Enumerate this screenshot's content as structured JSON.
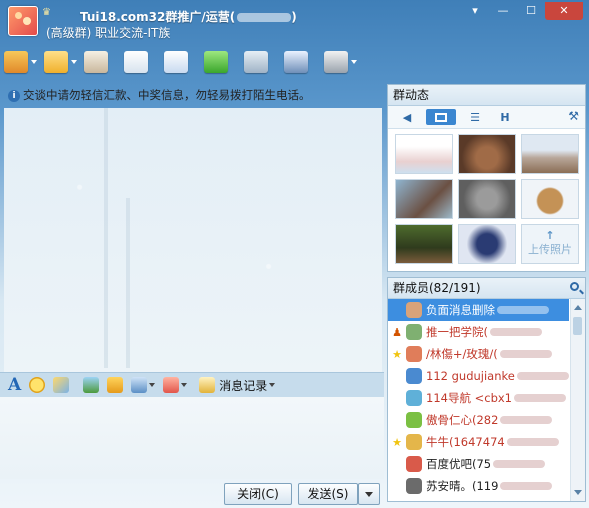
{
  "titlebar": {
    "title": "Tui18.com32群推广/运营(",
    "subtitle": "(高级群) 职业交流-IT族",
    "ctrl_skin": "▾",
    "ctrl_min": "—",
    "ctrl_max": "☐",
    "ctrl_close": "✕"
  },
  "toolbar": {
    "icons": [
      "home-icon",
      "folder-icon",
      "sidebar-icon",
      "card-icon",
      "email-icon",
      "add-icon",
      "settings-tool-icon",
      "user-icon",
      "gear-icon"
    ]
  },
  "chat": {
    "notice": "交谈中请勿轻信汇款、中奖信息，勿轻易拨打陌生电话。"
  },
  "input_toolbar": {
    "font_label": "A",
    "history_label": "消息记录"
  },
  "buttons": {
    "close": "关闭(C)",
    "send": "发送(S)"
  },
  "group_feed": {
    "title": "群动态",
    "tab_h": "H",
    "upload_label": "上传照片",
    "upload_arrow": "↑"
  },
  "members": {
    "title": "群成员(82/191)",
    "rows": [
      {
        "name": "负面消息删除",
        "color": "#ffffff",
        "selected": true,
        "badge": ""
      },
      {
        "name": "推一把学院(",
        "color": "#c0392b",
        "selected": false,
        "badge": "owner"
      },
      {
        "name": "/林傷+/玫瑰/(",
        "color": "#c0392b",
        "selected": false,
        "badge": "star"
      },
      {
        "name": "112 gudujianke",
        "color": "#c0392b",
        "selected": false,
        "badge": ""
      },
      {
        "name": "114导航 <cbx1",
        "color": "#c0392b",
        "selected": false,
        "badge": ""
      },
      {
        "name": "傲骨仁心(282",
        "color": "#c0392b",
        "selected": false,
        "badge": ""
      },
      {
        "name": "牛牛(1647474",
        "color": "#c0392b",
        "selected": false,
        "badge": "star"
      },
      {
        "name": "百度优吧(75",
        "color": "#222222",
        "selected": false,
        "badge": ""
      },
      {
        "name": "苏安晴。(119",
        "color": "#222222",
        "selected": false,
        "badge": ""
      }
    ]
  },
  "colors": {
    "accent": "#3d8ee0",
    "title_bg": "#3f7fb8",
    "member_red": "#c0392b"
  }
}
